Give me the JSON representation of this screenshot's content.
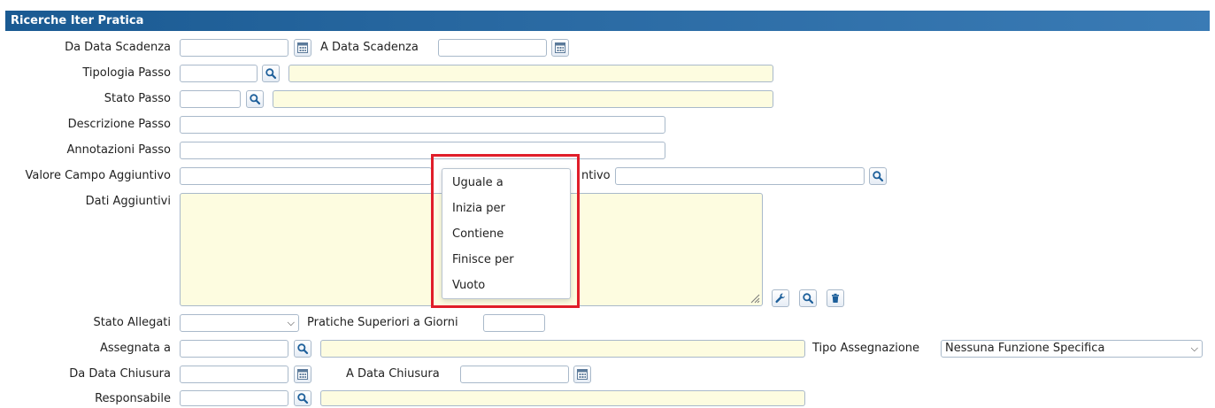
{
  "window": {
    "title": "Ricerche Iter Pratica"
  },
  "form": {
    "da_data_scadenza": "Da Data Scadenza",
    "a_data_scadenza": "A Data Scadenza",
    "tipologia_passo": "Tipologia Passo",
    "stato_passo": "Stato Passo",
    "descrizione_passo": "Descrizione Passo",
    "annotazioni_passo": "Annotazioni Passo",
    "valore_campo_aggiuntivo": "Valore Campo Aggiuntivo",
    "campo_aggiuntivo_partial": "ntivo",
    "dati_aggiuntivi": "Dati Aggiuntivi",
    "stato_allegati": "Stato Allegati",
    "pratiche_superiori": "Pratiche Superiori a Giorni",
    "assegnata_a": "Assegnata a",
    "tipo_assegnazione": "Tipo Assegnazione",
    "tipo_assegnazione_value": "Nessuna Funzione Specifica",
    "da_data_chiusura": "Da Data Chiusura",
    "a_data_chiusura": "A Data Chiusura",
    "responsabile": "Responsabile"
  },
  "dropdown": {
    "items": [
      "Uguale a",
      "Inizia per",
      "Contiene",
      "Finisce per",
      "Vuoto"
    ]
  },
  "icons": {
    "calendar": "calendar-icon",
    "search": "search-icon",
    "wrench": "wrench-icon",
    "trash": "trash-icon",
    "chevron": "chevron-down-icon"
  },
  "colors": {
    "title_bar": "#1a5a92",
    "highlight": "#e01e2a",
    "field_yellow": "#fdfce0"
  }
}
